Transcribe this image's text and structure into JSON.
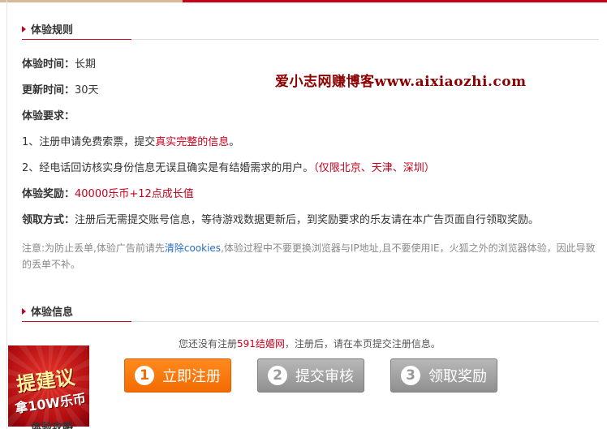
{
  "rules": {
    "heading": "体验规则",
    "time_label": "体验时间：",
    "time_value": "长期",
    "update_label": "更新时间：",
    "update_value": "30天",
    "req_label": "体验要求：",
    "req1_prefix": "1、注册申请免费索票，提交",
    "req1_highlight": "真实完整的信息",
    "req1_suffix": "。",
    "req2_text": "2、经电话回访核实身份信息无误且确实是有结婚需求的用户。",
    "req2_highlight": "（仅限北京、天津、深圳）",
    "reward_label": "体验奖励：",
    "reward_value": "40000乐币+12点成长值",
    "claim_label": "领取方式：",
    "claim_value": "注册后无需提交账号信息，等待游戏数据更新后，到奖励要求的乐友请在本广告页面自行领取奖励。",
    "note_prefix": "注意:为防止丢单,体验广告前请先",
    "note_link": "清除cookies",
    "note_suffix": ",体验过程中不要更换浏览器与IP地址,且不要使用IE，火狐之外的浏览器体验，因此导致的丢单不补。"
  },
  "watermark": "爱小志网赚博客www.aixiaozhi.com",
  "info": {
    "heading": "体验信息",
    "tip_prefix": "您还没有注册",
    "tip_site": "591结婚网",
    "tip_suffix": "，注册后，请在本页提交注册信息。",
    "steps": [
      {
        "num": "1",
        "label": "立即注册"
      },
      {
        "num": "2",
        "label": "提交审核"
      },
      {
        "num": "3",
        "label": "领取奖励"
      }
    ]
  },
  "suggest_badge": {
    "line1": "提建议",
    "line2": "拿10W乐币"
  },
  "next_heading": "体验攻略"
}
